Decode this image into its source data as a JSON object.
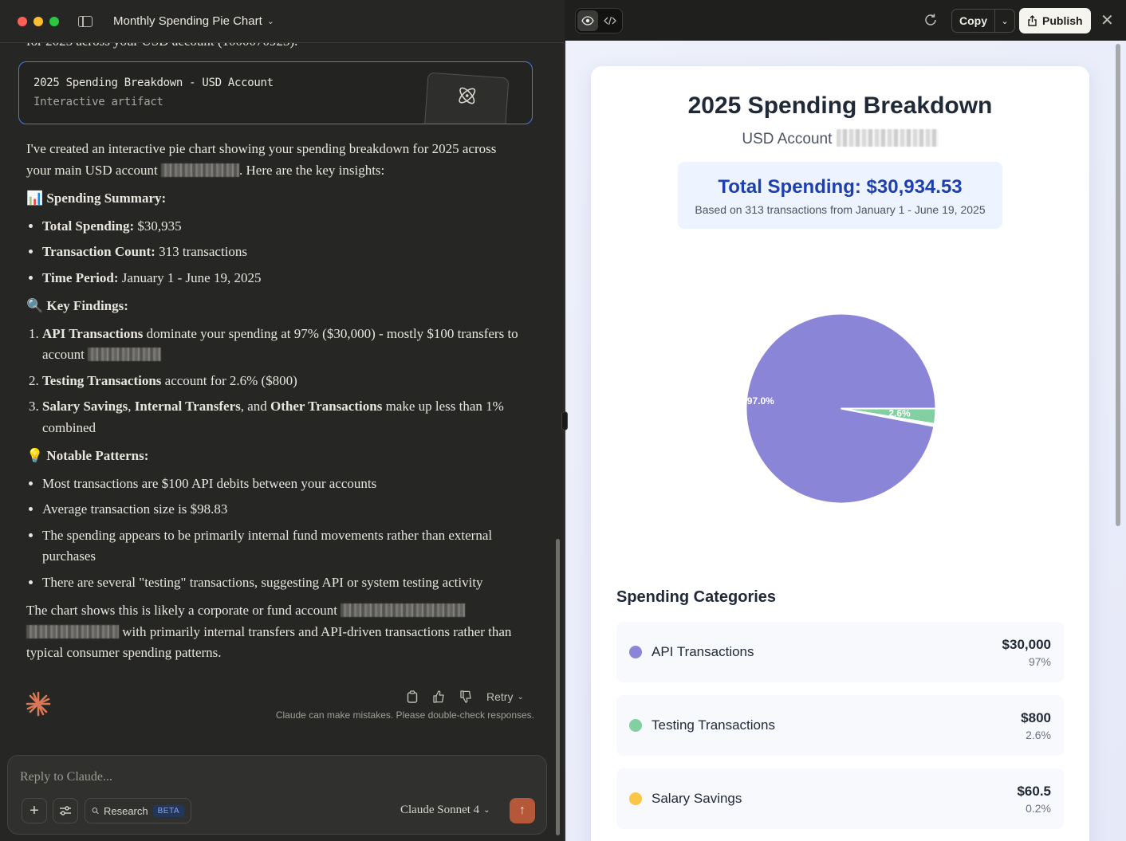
{
  "window": {
    "title": "Monthly Spending Pie Chart"
  },
  "chat": {
    "clipped_line": "for 2025 across your USD account (1000070923).",
    "artifact": {
      "title": "2025 Spending Breakdown - USD Account",
      "subtitle": "Interactive artifact"
    },
    "intro_a": "I've created an interactive pie chart showing your spending breakdown for 2025 across your main USD account",
    "intro_b": ". Here are the key insights:",
    "summary_heading": "📊 Spending Summary:",
    "summary": [
      {
        "label": "Total Spending:",
        "value": " $30,935"
      },
      {
        "label": "Transaction Count:",
        "value": " 313 transactions"
      },
      {
        "label": "Time Period:",
        "value": " January 1 - June 19, 2025"
      }
    ],
    "findings_heading": "🔍 Key Findings:",
    "finding1_bold": "API Transactions",
    "finding1_text": " dominate your spending at 97% ($30,000) - mostly $100 transfers to account",
    "finding2_bold": "Testing Transactions",
    "finding2_text": " account for 2.6% ($800)",
    "finding3_b1": "Salary Savings",
    "finding3_sep1": ", ",
    "finding3_b2": "Internal Transfers",
    "finding3_sep2": ", and ",
    "finding3_b3": "Other Transactions",
    "finding3_text": " make up less than 1% combined",
    "patterns_heading": "💡 Notable Patterns:",
    "patterns": [
      "Most transactions are $100 API debits between your accounts",
      "Average transaction size is $98.83",
      "The spending appears to be primarily internal fund movements rather than external purchases",
      "There are several \"testing\" transactions, suggesting API or system testing activity"
    ],
    "closing_a": "The chart shows this is likely a corporate or fund account",
    "closing_b": " with primarily internal transfers and API-driven transactions rather than typical consumer spending patterns.",
    "retry_label": "Retry",
    "disclaimer": "Claude can make mistakes. Please double-check responses."
  },
  "composer": {
    "placeholder": "Reply to Claude...",
    "research_label": "Research",
    "beta_label": "BETA",
    "model": "Claude Sonnet 4"
  },
  "artifact_bar": {
    "copy_label": "Copy",
    "publish_label": "Publish"
  },
  "artifact_view": {
    "title": "2025 Spending Breakdown",
    "account_label": "USD Account",
    "total_label": "Total Spending: $30,934.53",
    "total_sub": "Based on 313 transactions from January 1 - June 19, 2025",
    "categories_title": "Spending Categories"
  },
  "chart_data": {
    "type": "pie",
    "slices": [
      {
        "name": "API Transactions",
        "amount": "$30,000",
        "percent_label": "97%",
        "value": 97.0,
        "color": "#8b85d8",
        "slice_label": "97.0%"
      },
      {
        "name": "Testing Transactions",
        "amount": "$800",
        "percent_label": "2.6%",
        "value": 2.6,
        "color": "#82cfa2",
        "slice_label": "2.6%"
      },
      {
        "name": "Salary Savings",
        "amount": "$60.5",
        "percent_label": "0.2%",
        "value": 0.2,
        "color": "#fbc545",
        "slice_label": ""
      },
      {
        "name": "Internal Transfers",
        "amount": "",
        "percent_label": "",
        "value": 0.1,
        "color": "#f28a6b",
        "slice_label": ""
      },
      {
        "name": "Other Transactions",
        "amount": "",
        "percent_label": "",
        "value": 0.1,
        "color": "#9ad0e8",
        "slice_label": ""
      }
    ]
  },
  "colors": {
    "accent_blue": "#1e40af",
    "send_button": "#b5583a",
    "artifact_border": "#4b7bd6"
  }
}
